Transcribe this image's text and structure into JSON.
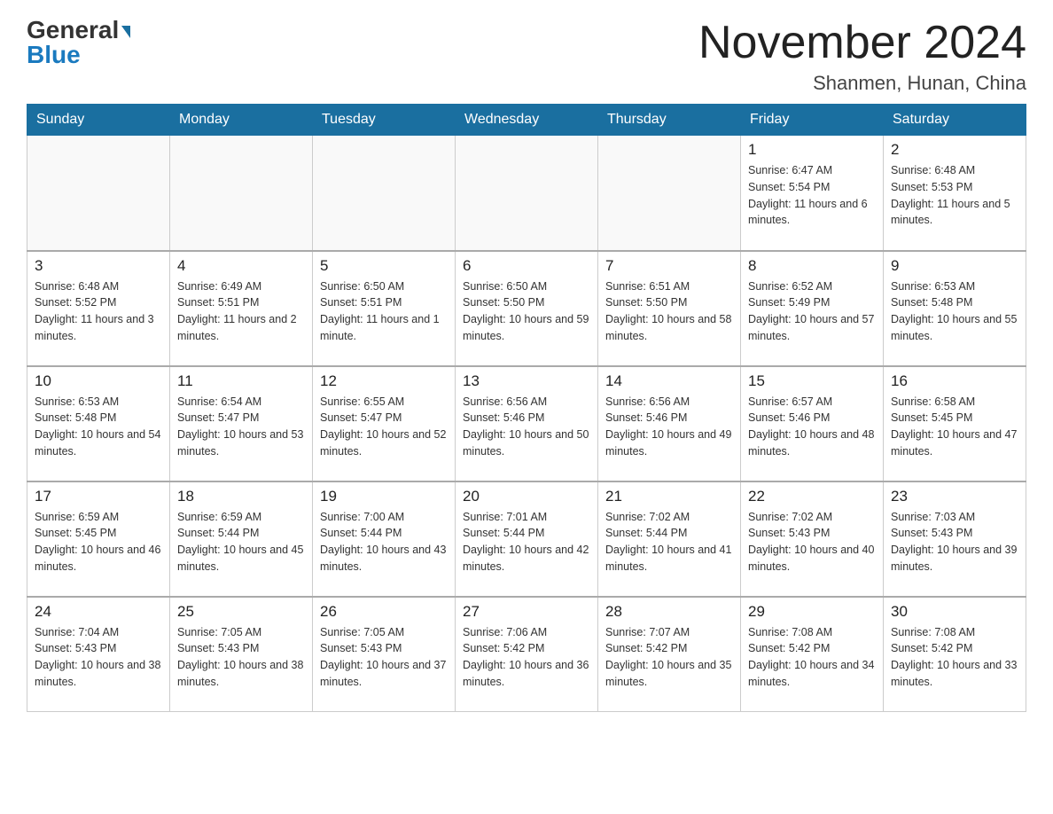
{
  "header": {
    "logo_general": "General",
    "logo_blue": "Blue",
    "month": "November 2024",
    "location": "Shanmen, Hunan, China"
  },
  "days_of_week": [
    "Sunday",
    "Monday",
    "Tuesday",
    "Wednesday",
    "Thursday",
    "Friday",
    "Saturday"
  ],
  "weeks": [
    {
      "cells": [
        {
          "day": "",
          "info": ""
        },
        {
          "day": "",
          "info": ""
        },
        {
          "day": "",
          "info": ""
        },
        {
          "day": "",
          "info": ""
        },
        {
          "day": "",
          "info": ""
        },
        {
          "day": "1",
          "info": "Sunrise: 6:47 AM\nSunset: 5:54 PM\nDaylight: 11 hours and 6 minutes."
        },
        {
          "day": "2",
          "info": "Sunrise: 6:48 AM\nSunset: 5:53 PM\nDaylight: 11 hours and 5 minutes."
        }
      ]
    },
    {
      "cells": [
        {
          "day": "3",
          "info": "Sunrise: 6:48 AM\nSunset: 5:52 PM\nDaylight: 11 hours and 3 minutes."
        },
        {
          "day": "4",
          "info": "Sunrise: 6:49 AM\nSunset: 5:51 PM\nDaylight: 11 hours and 2 minutes."
        },
        {
          "day": "5",
          "info": "Sunrise: 6:50 AM\nSunset: 5:51 PM\nDaylight: 11 hours and 1 minute."
        },
        {
          "day": "6",
          "info": "Sunrise: 6:50 AM\nSunset: 5:50 PM\nDaylight: 10 hours and 59 minutes."
        },
        {
          "day": "7",
          "info": "Sunrise: 6:51 AM\nSunset: 5:50 PM\nDaylight: 10 hours and 58 minutes."
        },
        {
          "day": "8",
          "info": "Sunrise: 6:52 AM\nSunset: 5:49 PM\nDaylight: 10 hours and 57 minutes."
        },
        {
          "day": "9",
          "info": "Sunrise: 6:53 AM\nSunset: 5:48 PM\nDaylight: 10 hours and 55 minutes."
        }
      ]
    },
    {
      "cells": [
        {
          "day": "10",
          "info": "Sunrise: 6:53 AM\nSunset: 5:48 PM\nDaylight: 10 hours and 54 minutes."
        },
        {
          "day": "11",
          "info": "Sunrise: 6:54 AM\nSunset: 5:47 PM\nDaylight: 10 hours and 53 minutes."
        },
        {
          "day": "12",
          "info": "Sunrise: 6:55 AM\nSunset: 5:47 PM\nDaylight: 10 hours and 52 minutes."
        },
        {
          "day": "13",
          "info": "Sunrise: 6:56 AM\nSunset: 5:46 PM\nDaylight: 10 hours and 50 minutes."
        },
        {
          "day": "14",
          "info": "Sunrise: 6:56 AM\nSunset: 5:46 PM\nDaylight: 10 hours and 49 minutes."
        },
        {
          "day": "15",
          "info": "Sunrise: 6:57 AM\nSunset: 5:46 PM\nDaylight: 10 hours and 48 minutes."
        },
        {
          "day": "16",
          "info": "Sunrise: 6:58 AM\nSunset: 5:45 PM\nDaylight: 10 hours and 47 minutes."
        }
      ]
    },
    {
      "cells": [
        {
          "day": "17",
          "info": "Sunrise: 6:59 AM\nSunset: 5:45 PM\nDaylight: 10 hours and 46 minutes."
        },
        {
          "day": "18",
          "info": "Sunrise: 6:59 AM\nSunset: 5:44 PM\nDaylight: 10 hours and 45 minutes."
        },
        {
          "day": "19",
          "info": "Sunrise: 7:00 AM\nSunset: 5:44 PM\nDaylight: 10 hours and 43 minutes."
        },
        {
          "day": "20",
          "info": "Sunrise: 7:01 AM\nSunset: 5:44 PM\nDaylight: 10 hours and 42 minutes."
        },
        {
          "day": "21",
          "info": "Sunrise: 7:02 AM\nSunset: 5:44 PM\nDaylight: 10 hours and 41 minutes."
        },
        {
          "day": "22",
          "info": "Sunrise: 7:02 AM\nSunset: 5:43 PM\nDaylight: 10 hours and 40 minutes."
        },
        {
          "day": "23",
          "info": "Sunrise: 7:03 AM\nSunset: 5:43 PM\nDaylight: 10 hours and 39 minutes."
        }
      ]
    },
    {
      "cells": [
        {
          "day": "24",
          "info": "Sunrise: 7:04 AM\nSunset: 5:43 PM\nDaylight: 10 hours and 38 minutes."
        },
        {
          "day": "25",
          "info": "Sunrise: 7:05 AM\nSunset: 5:43 PM\nDaylight: 10 hours and 38 minutes."
        },
        {
          "day": "26",
          "info": "Sunrise: 7:05 AM\nSunset: 5:43 PM\nDaylight: 10 hours and 37 minutes."
        },
        {
          "day": "27",
          "info": "Sunrise: 7:06 AM\nSunset: 5:42 PM\nDaylight: 10 hours and 36 minutes."
        },
        {
          "day": "28",
          "info": "Sunrise: 7:07 AM\nSunset: 5:42 PM\nDaylight: 10 hours and 35 minutes."
        },
        {
          "day": "29",
          "info": "Sunrise: 7:08 AM\nSunset: 5:42 PM\nDaylight: 10 hours and 34 minutes."
        },
        {
          "day": "30",
          "info": "Sunrise: 7:08 AM\nSunset: 5:42 PM\nDaylight: 10 hours and 33 minutes."
        }
      ]
    }
  ]
}
